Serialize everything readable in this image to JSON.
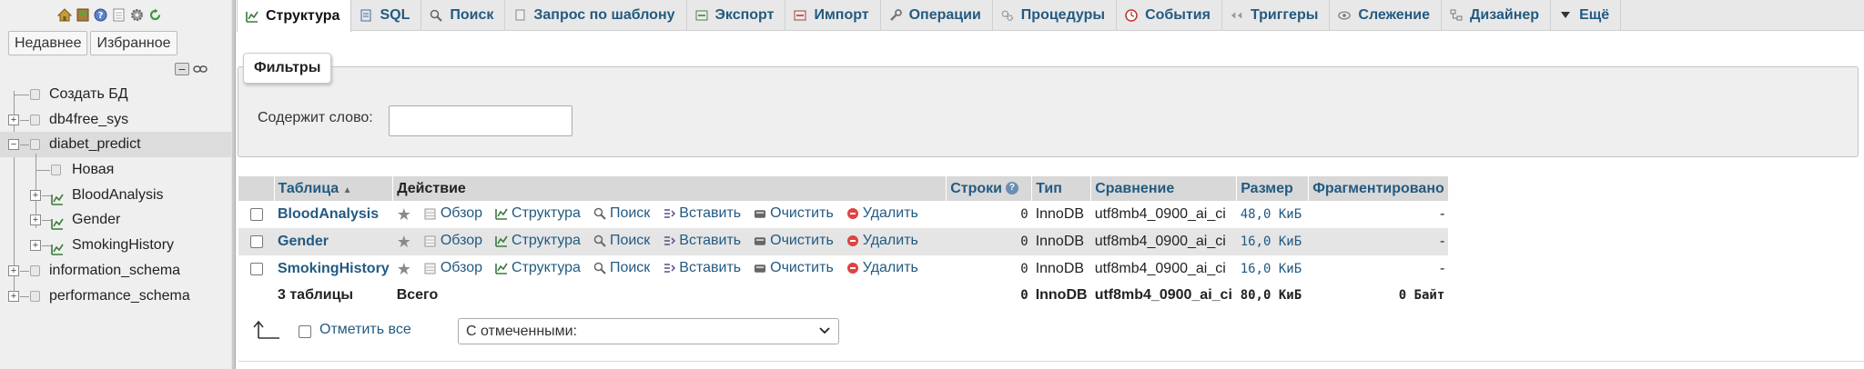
{
  "sidebar": {
    "logo_links": [
      "home-icon",
      "logout-icon",
      "help-icon",
      "docs-icon",
      "settings-icon",
      "reload-icon"
    ],
    "tabs": [
      "Недавнее",
      "Избранное"
    ],
    "tree": {
      "create_db": "Создать БД",
      "databases": [
        {
          "name": "db4free_sys"
        },
        {
          "name": "diabet_predict"
        },
        {
          "name": "information_schema"
        },
        {
          "name": "performance_schema"
        }
      ],
      "children": {
        "new": "Новая",
        "tables": [
          "BloodAnalysis",
          "Gender",
          "SmokingHistory"
        ]
      }
    }
  },
  "menu": [
    {
      "label": "Структура",
      "icon": "structure-icon",
      "active": true
    },
    {
      "label": "SQL",
      "icon": "sql-icon"
    },
    {
      "label": "Поиск",
      "icon": "search-icon"
    },
    {
      "label": "Запрос по шаблону",
      "icon": "query-icon"
    },
    {
      "label": "Экспорт",
      "icon": "export-icon"
    },
    {
      "label": "Импорт",
      "icon": "import-icon"
    },
    {
      "label": "Операции",
      "icon": "wrench-icon"
    },
    {
      "label": "Процедуры",
      "icon": "routines-icon"
    },
    {
      "label": "События",
      "icon": "events-icon"
    },
    {
      "label": "Триггеры",
      "icon": "triggers-icon"
    },
    {
      "label": "Слежение",
      "icon": "tracking-icon"
    },
    {
      "label": "Дизайнер",
      "icon": "designer-icon"
    },
    {
      "label": "Ещё",
      "icon": "caret-down-icon"
    }
  ],
  "filters": {
    "legend": "Фильтры",
    "label": "Содержит слово:",
    "value": ""
  },
  "table": {
    "headers": {
      "table": "Таблица",
      "action": "Действие",
      "rows": "Строки",
      "type": "Тип",
      "collation": "Сравнение",
      "size": "Размер",
      "overhead": "Фрагментировано"
    },
    "actions": {
      "browse": "Обзор",
      "structure": "Структура",
      "search": "Поиск",
      "insert": "Вставить",
      "empty": "Очистить",
      "drop": "Удалить"
    },
    "rows": [
      {
        "name": "BloodAnalysis",
        "rows": "0",
        "type": "InnoDB",
        "collation": "utf8mb4_0900_ai_ci",
        "size": "48,0 КиБ",
        "overhead": "-"
      },
      {
        "name": "Gender",
        "rows": "0",
        "type": "InnoDB",
        "collation": "utf8mb4_0900_ai_ci",
        "size": "16,0 КиБ",
        "overhead": "-"
      },
      {
        "name": "SmokingHistory",
        "rows": "0",
        "type": "InnoDB",
        "collation": "utf8mb4_0900_ai_ci",
        "size": "16,0 КиБ",
        "overhead": "-"
      }
    ],
    "summary": {
      "count": "3 таблицы",
      "label": "Всего",
      "rows": "0",
      "type": "InnoDB",
      "collation": "utf8mb4_0900_ai_ci",
      "size": "80,0 КиБ",
      "overhead": "0 Байт"
    }
  },
  "bottom": {
    "check_all": "Отметить все",
    "with_selected": "С отмеченными:"
  }
}
